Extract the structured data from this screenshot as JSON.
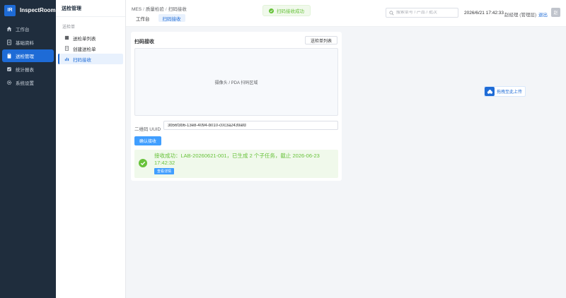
{
  "brand": {
    "logo": "IR",
    "name": "InspectRoom"
  },
  "sidebar": {
    "items": [
      {
        "label": "工作台",
        "icon": "home-icon",
        "active": false
      },
      {
        "label": "基础资料",
        "icon": "document-icon",
        "active": false
      },
      {
        "label": "送检管理",
        "icon": "clipboard-icon",
        "active": true
      },
      {
        "label": "统计报表",
        "icon": "checkbox-icon",
        "active": false
      },
      {
        "label": "系统设置",
        "icon": "gear-icon",
        "active": false
      }
    ]
  },
  "submenu": {
    "title": "送检管理",
    "group": "送检单",
    "items": [
      {
        "label": "送检单列表",
        "icon": "list-icon",
        "active": false
      },
      {
        "label": "创建送检单",
        "icon": "doc-create-icon",
        "active": false
      },
      {
        "label": "扫码接收",
        "icon": "scan-icon",
        "active": true
      }
    ]
  },
  "header": {
    "breadcrumb": [
      "MES",
      "质量检验",
      "扫码接收"
    ],
    "tabs": [
      {
        "label": "工作台",
        "active": false
      },
      {
        "label": "扫码接收",
        "active": true
      }
    ],
    "toast": "扫码接收成功",
    "search_placeholder": "搜索单号 / 产品 / 批次",
    "datetime": "2026/6/21 17:42:33",
    "user": "赵经理 (管理层)",
    "logout": "退出",
    "avatar": "赵"
  },
  "card": {
    "title": "扫码接收",
    "list_button": "送检单列表",
    "scan_area_text": "摄像头 / PDA 扫码区域",
    "uuid_label": "二维码 UUID",
    "uuid_value": "3b56f3b6-13e8-4094-b010-c0c3a2439afd",
    "confirm_button": "确认接收",
    "success_message": "接收成功：LAB-20260621-001，已生成 2 个子任务，截止 2026-06-23 17:42:32",
    "detail_button": "查看详情"
  },
  "upload": {
    "label": "拖拽至此上传"
  },
  "colors": {
    "primary": "#1e6bd6",
    "success": "#67c23a",
    "sidebar_bg": "#1f2d3d"
  }
}
